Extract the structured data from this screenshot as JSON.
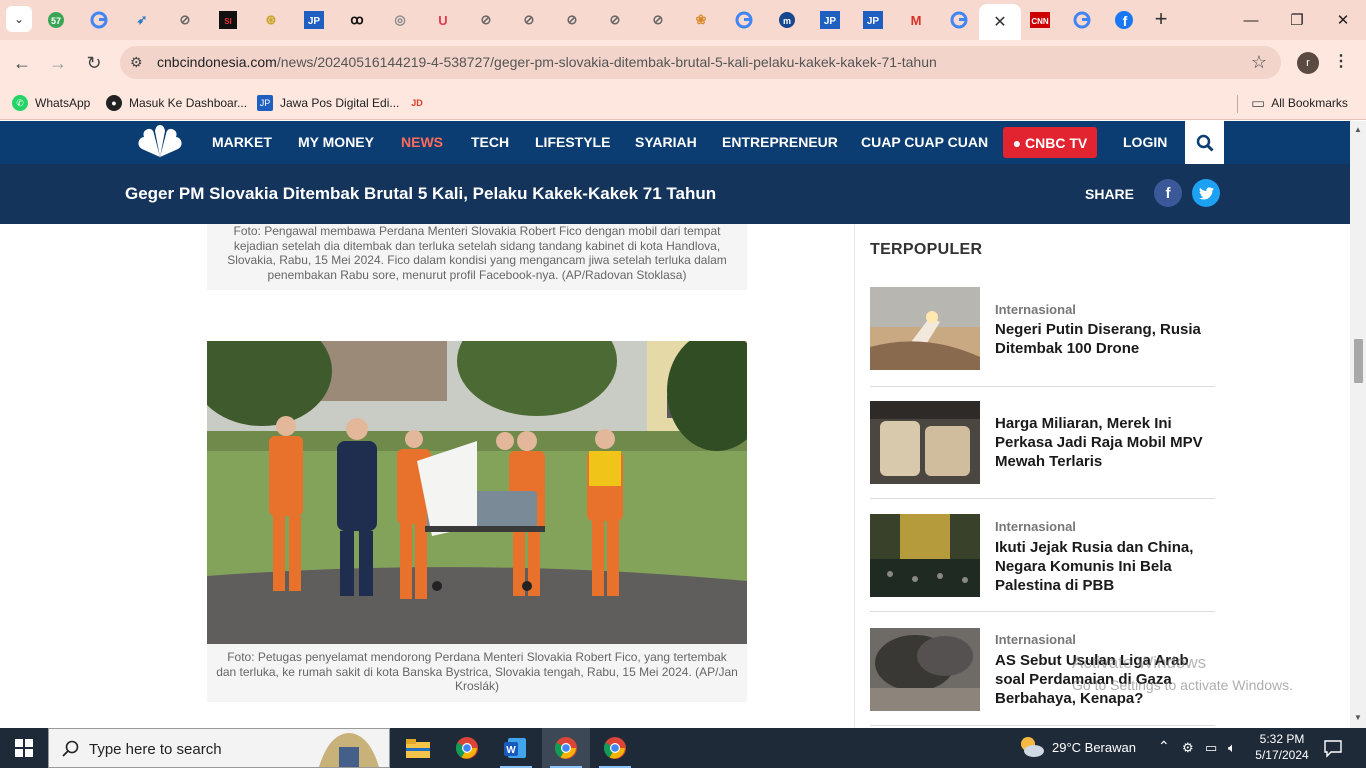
{
  "browser": {
    "tabs_dropdown_icon": "chevron-down-icon",
    "active_tab_close": "✕",
    "new_tab": "+",
    "window_controls": [
      "—",
      "❐",
      "✕"
    ],
    "url_domain": "cnbcindonesia.com",
    "url_path": "/news/20240516144219-4-538727/geger-pm-slovakia-ditembak-brutal-5-kali-pelaku-kakek-kakek-71-tahun",
    "profile_initial": "r",
    "bookmarks": [
      {
        "label": "WhatsApp",
        "color": "#25d366"
      },
      {
        "label": "Masuk Ke Dashboar...",
        "color": "#222222"
      },
      {
        "label": "Jawa Pos Digital Edi...",
        "color": "#1f5fbf"
      },
      {
        "label": "",
        "color": "#e23a2d"
      }
    ],
    "all_bookmarks": "All Bookmarks"
  },
  "site": {
    "nav": [
      "MARKET",
      "MY MONEY",
      "NEWS",
      "TECH",
      "LIFESTYLE",
      "SYARIAH",
      "ENTREPRENEUR",
      "CUAP CUAP CUAN"
    ],
    "cnbc_tv": "● CNBC TV",
    "login": "LOGIN",
    "article_title": "Geger PM Slovakia Ditembak Brutal 5 Kali, Pelaku Kakek-Kakek 71 Tahun",
    "share": "SHARE"
  },
  "article": {
    "caption1": "Foto: Pengawal membawa Perdana Menteri Slovakia Robert Fico dengan mobil dari tempat kejadian setelah dia ditembak dan terluka setelah sidang tandang kabinet di kota Handlova, Slovakia, Rabu, 15 Mei 2024. Fico dalam kondisi yang mengancam jiwa setelah terluka dalam penembakan Rabu sore, menurut profil Facebook-nya. (AP/Radovan Stoklasa)",
    "caption2": "Foto: Petugas penyelamat mendorong Perdana Menteri Slovakia Robert Fico, yang tertembak dan terluka, ke rumah sakit di kota Banska Bystrica, Slovakia tengah, Rabu, 15 Mei 2024. (AP/Jan Kroslák)"
  },
  "sidebar": {
    "heading": "TERPOPULER",
    "items": [
      {
        "category": "Internasional",
        "title": "Negeri Putin Diserang, Rusia Ditembak 100 Drone"
      },
      {
        "category": "",
        "title": "Harga Miliaran, Merek Ini Perkasa Jadi Raja Mobil MPV Mewah Terlaris"
      },
      {
        "category": "Internasional",
        "title": "Ikuti Jejak Rusia dan China, Negara Komunis Ini Bela Palestina di PBB"
      },
      {
        "category": "Internasional",
        "title": "AS Sebut Usulan Liga Arab soal Perdamaian di Gaza Berbahaya, Kenapa?"
      }
    ]
  },
  "overlay": {
    "activate_title": "Activate Windows",
    "activate_sub": "Go to Settings to activate Windows."
  },
  "taskbar": {
    "search_placeholder": "Type here to search",
    "weather": "29°C  Berawan",
    "time": "5:32 PM",
    "date": "5/17/2024"
  }
}
